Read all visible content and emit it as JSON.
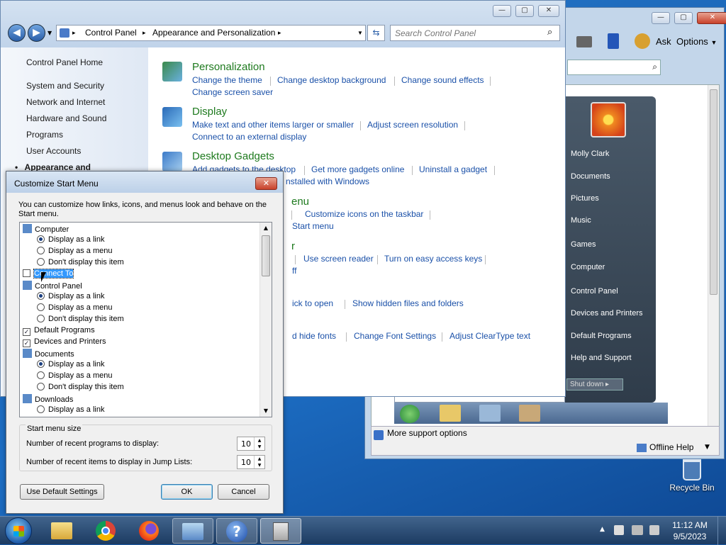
{
  "controlPanel": {
    "breadcrumb": [
      "Control Panel",
      "Appearance and Personalization"
    ],
    "search_placeholder": "Search Control Panel",
    "sidebar": [
      "Control Panel Home",
      "System and Security",
      "Network and Internet",
      "Hardware and Sound",
      "Programs",
      "User Accounts",
      "Appearance and"
    ],
    "categories": [
      {
        "title": "Personalization",
        "links": [
          "Change the theme",
          "Change desktop background",
          "Change sound effects",
          "Change screen saver"
        ]
      },
      {
        "title": "Display",
        "links": [
          "Make text and other items larger or smaller",
          "Adjust screen resolution",
          "Connect to an external display"
        ]
      },
      {
        "title": "Desktop Gadgets",
        "links": [
          "Add gadgets to the desktop",
          "Get more gadgets online",
          "Uninstall a gadget",
          "nstalled with Windows"
        ]
      }
    ],
    "partial": [
      "enu",
      "Customize icons on the taskbar",
      "Start menu",
      "r",
      "Use screen reader",
      "Turn on easy access keys",
      "ff",
      "ick to open",
      "Show hidden files and folders",
      "d hide fonts",
      "Change Font Settings",
      "Adjust ClearType text"
    ]
  },
  "helpWindow": {
    "toolbar": {
      "ask": "Ask",
      "options": "Options"
    },
    "startMenu": [
      "Molly Clark",
      "Documents",
      "Pictures",
      "Music",
      "Games",
      "Computer",
      "Control Panel",
      "Devices and Printers",
      "Default Programs",
      "Help and Support"
    ],
    "shutdown": "Shut down",
    "support": "More support options",
    "offline": "Offline Help"
  },
  "dialog": {
    "title": "Customize Start Menu",
    "description": "You can customize how links, icons, and menus look and behave on the Start menu.",
    "items": [
      {
        "type": "header",
        "label": "Computer"
      },
      {
        "type": "radio",
        "label": "Display as a link",
        "on": true
      },
      {
        "type": "radio",
        "label": "Display as a menu",
        "on": false
      },
      {
        "type": "radio",
        "label": "Don't display this item",
        "on": false
      },
      {
        "type": "check",
        "label": "Connect To",
        "on": false,
        "selected": true
      },
      {
        "type": "header",
        "label": "Control Panel"
      },
      {
        "type": "radio",
        "label": "Display as a link",
        "on": true
      },
      {
        "type": "radio",
        "label": "Display as a menu",
        "on": false
      },
      {
        "type": "radio",
        "label": "Don't display this item",
        "on": false
      },
      {
        "type": "check",
        "label": "Default Programs",
        "on": true
      },
      {
        "type": "check",
        "label": "Devices and Printers",
        "on": true
      },
      {
        "type": "header",
        "label": "Documents"
      },
      {
        "type": "radio",
        "label": "Display as a link",
        "on": true
      },
      {
        "type": "radio",
        "label": "Display as a menu",
        "on": false
      },
      {
        "type": "radio",
        "label": "Don't display this item",
        "on": false
      },
      {
        "type": "header",
        "label": "Downloads"
      },
      {
        "type": "radio",
        "label": "Display as a link",
        "on": false
      }
    ],
    "sizeGroup": "Start menu size",
    "recentPrograms": {
      "label": "Number of recent programs to display:",
      "value": "10"
    },
    "recentItems": {
      "label": "Number of recent items to display in Jump Lists:",
      "value": "10"
    },
    "buttons": {
      "default": "Use Default Settings",
      "ok": "OK",
      "cancel": "Cancel"
    }
  },
  "desktop": {
    "recycle": "Recycle Bin"
  },
  "taskbar": {
    "time": "11:12 AM",
    "date": "9/5/2023"
  }
}
